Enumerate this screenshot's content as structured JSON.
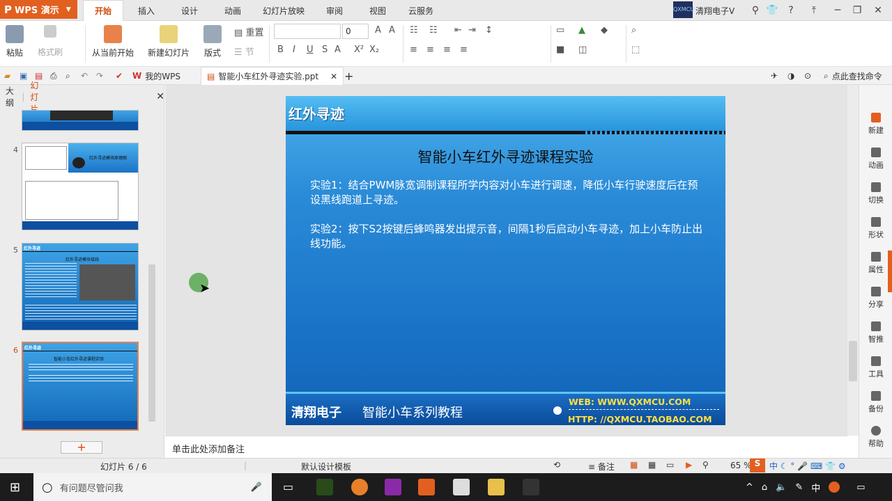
{
  "app": {
    "name": "WPS 演示",
    "user_name": "清翔电子V",
    "user_avatar_text": "QXMCU",
    "accent_color": "#d24a0d"
  },
  "menu_tabs": [
    "开始",
    "插入",
    "设计",
    "动画",
    "幻灯片放映",
    "审阅",
    "视图",
    "云服务"
  ],
  "ribbon": {
    "paste": "粘贴",
    "format_painter": "格式刷",
    "from_current": "从当前开始",
    "new_slide": "新建幻灯片",
    "layout": "版式",
    "reset": "重置",
    "section": "节",
    "font_name": "",
    "font_size": "0"
  },
  "doc_tabs": {
    "home": "我的WPS",
    "active": "智能小车红外寻迹实验.ppt",
    "search": "点此查找命令"
  },
  "panel": {
    "outline": "大纲",
    "slides": "幻灯片",
    "thumbs": [
      {
        "num": "4",
        "title": "红外寻迹模块原理图"
      },
      {
        "num": "5",
        "title": "红外寻迹",
        "subtitle": "红外寻迹模块接线"
      },
      {
        "num": "6",
        "title": "红外寻迹",
        "subtitle": "智能小车红外寻迹课程实验"
      }
    ]
  },
  "slide": {
    "header": "红外寻迹",
    "heading": "智能小车红外寻迹课程实验",
    "para1": "实验1：结合PWM脉宽调制课程所学内容对小车进行调速，降低小车行驶速度后在预设黑线跑道上寻迹。",
    "para2": "实验2：按下S2按键后蜂鸣器发出提示音，间隔1秒后启动小车寻迹，加上小车防止出线功能。",
    "footer_brand": "清翔电子",
    "footer_series": "智能小车系列教程",
    "footer_web": "WEB: WWW.QXMCU.COM",
    "footer_http": "HTTP: //QXMCU.TAOBAO.COM"
  },
  "sidebar": [
    "新建",
    "动画",
    "切换",
    "形状",
    "属性",
    "分享",
    "智推",
    "工具",
    "备份",
    "帮助"
  ],
  "notes": "单击此处添加备注",
  "status": {
    "slide_count": "幻灯片 6 / 6",
    "template": "默认设计模板",
    "notes_btn": "备注",
    "zoom": "65 %"
  },
  "taskbar": {
    "search_placeholder": "有问题尽管问我",
    "time_lang": "中"
  }
}
